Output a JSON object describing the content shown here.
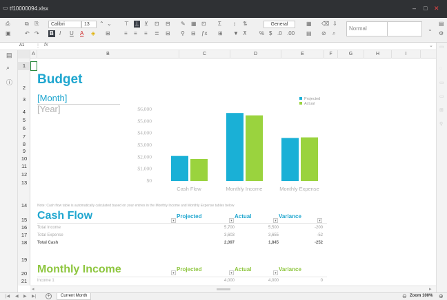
{
  "window": {
    "title": "tf10000094.xlsx",
    "minimize": "–",
    "maximize": "□",
    "close": "✕"
  },
  "ribbon": {
    "font_name": "Calibri",
    "font_size": "13",
    "number_format": "General",
    "style_value": "Normal",
    "bold": "B",
    "italic": "I",
    "underline": "U",
    "percent": "%",
    "sum": "Σ",
    "sort": "↕",
    "text_color": "A",
    "fill": "◈",
    "borders": "⊞",
    "align_top": "⊤",
    "align_mid": "⊥",
    "align_bot": "⊻",
    "merge": "⊟",
    "wrap": "⊡",
    "filter": "▼",
    "insert": "⊞",
    "format": "▦"
  },
  "formula_bar": {
    "cell_ref": "A1",
    "fx": "fx",
    "content": ""
  },
  "columns": [
    "A",
    "B",
    "C",
    "D",
    "E",
    "F",
    "G",
    "H",
    "I"
  ],
  "rows": [
    "1",
    "2",
    "3",
    "4",
    "5",
    "6",
    "7",
    "8",
    "9",
    "10",
    "11",
    "12",
    "13",
    "14",
    "15",
    "16",
    "17",
    "18",
    "19",
    "20",
    "21"
  ],
  "sheet": {
    "budget_title": "Budget",
    "month": "[Month]",
    "year": "[Year]",
    "note": "Note: Cash flow table is automatically calculated based on your entries in the Monthly Income and Monthly Expense tables below",
    "cash_flow_title": "Cash Flow",
    "col_projected": "Projected",
    "col_actual": "Actual",
    "col_variance": "Variance",
    "cashflow_rows": [
      {
        "label": "Total Income",
        "projected": "5,700",
        "actual": "5,500",
        "variance": "-200"
      },
      {
        "label": "Total Expense",
        "projected": "3,603",
        "actual": "3,655",
        "variance": "-52"
      },
      {
        "label": "Total Cash",
        "projected": "2,097",
        "actual": "1,845",
        "variance": "-252"
      }
    ],
    "monthly_income_title": "Monthly Income",
    "income_rows": [
      {
        "label": "Income 1",
        "projected": "4,000",
        "actual": "4,000",
        "variance": "0"
      }
    ]
  },
  "chart_data": {
    "type": "bar",
    "categories": [
      "Cash Flow",
      "Monthly Income",
      "Monthly Expense"
    ],
    "series": [
      {
        "name": "Projected",
        "values": [
          2097,
          5700,
          3603
        ],
        "color": "#1ab0d6"
      },
      {
        "name": "Actual",
        "values": [
          1845,
          5500,
          3655
        ],
        "color": "#9ad33e"
      }
    ],
    "y_tick_labels": [
      "$6,000",
      "$5,000",
      "$4,000",
      "$3,000",
      "$2,000",
      "$1,000",
      "$0"
    ],
    "ylim": [
      0,
      6000
    ],
    "legend_position": "top-right",
    "grid": false
  },
  "tabs": {
    "nav": [
      "|◀",
      "◀",
      "▶",
      "▶|"
    ],
    "add": "+",
    "sheet_name": "Current Month",
    "zoom_label": "Zoom 100%"
  }
}
